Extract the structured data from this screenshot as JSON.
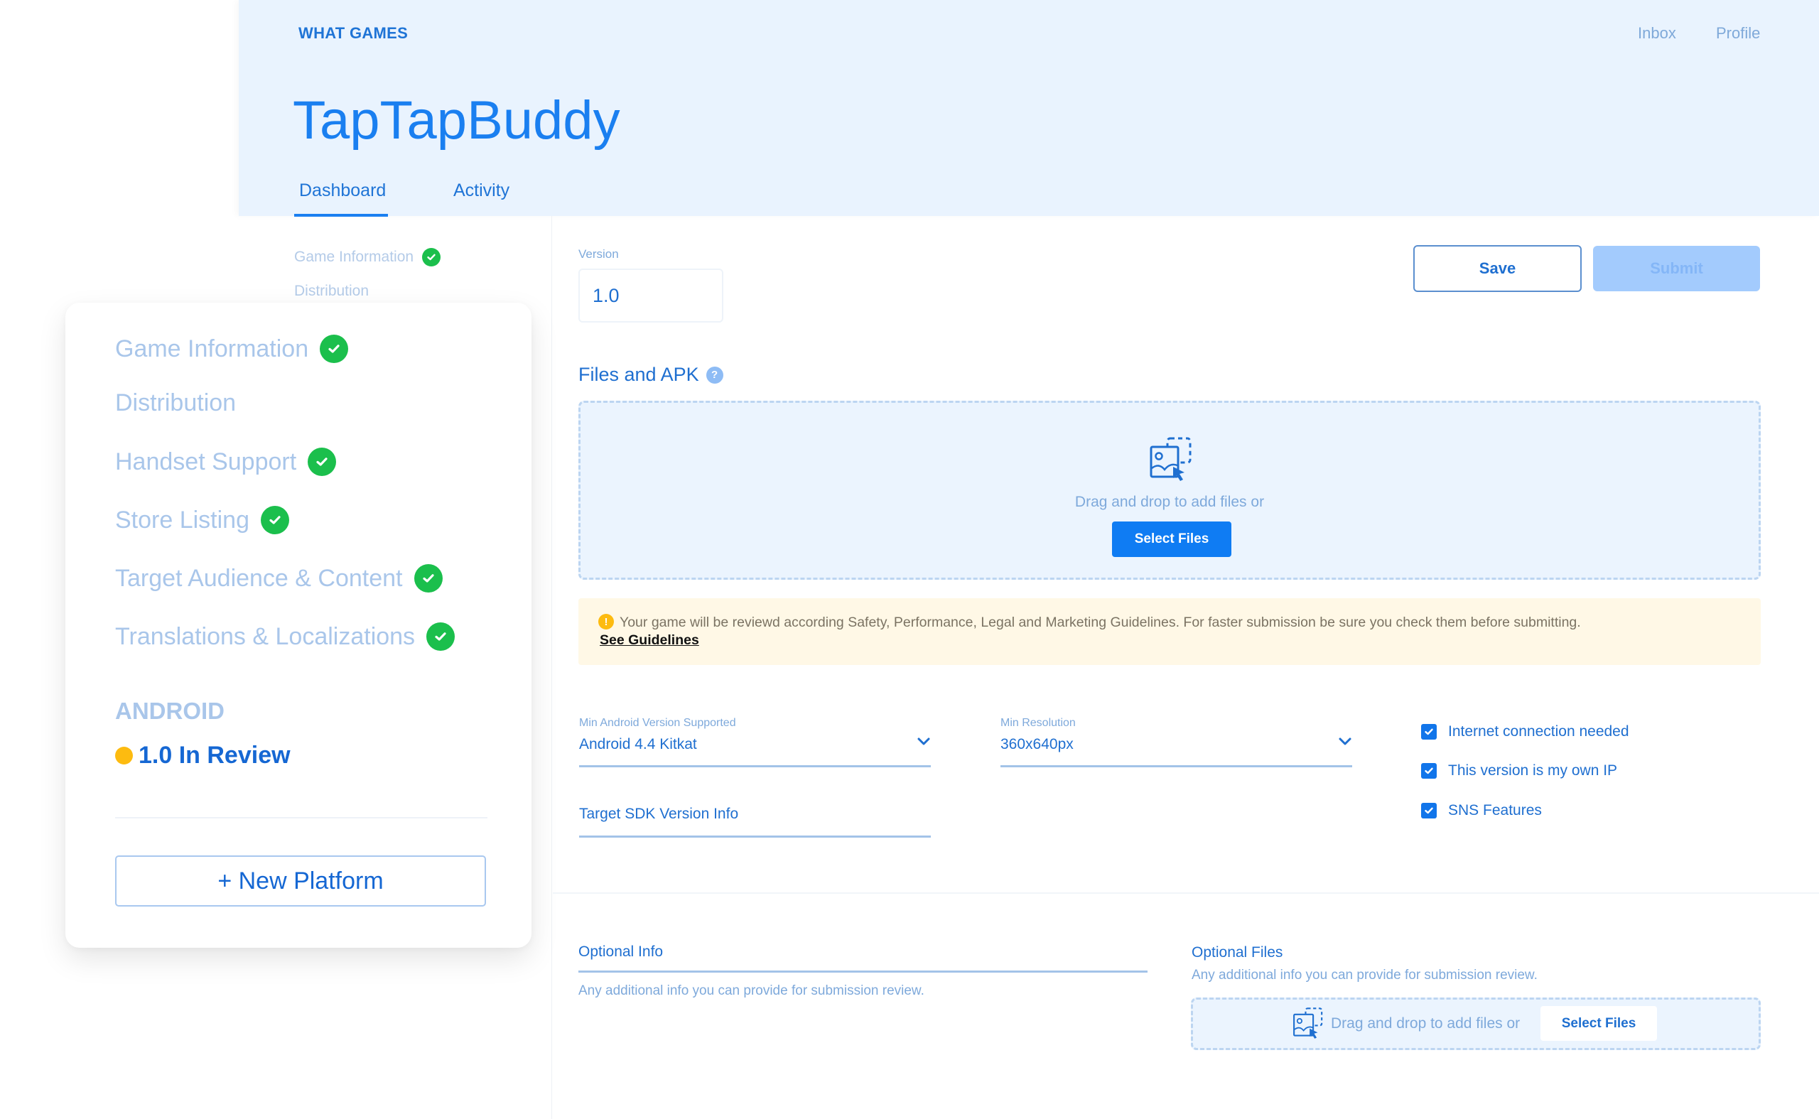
{
  "header": {
    "brand": "WHAT GAMES",
    "links": {
      "inbox": "Inbox",
      "profile": "Profile"
    },
    "title": "TapTapBuddy",
    "tabs": [
      {
        "label": "Dashboard",
        "active": true
      },
      {
        "label": "Activity",
        "active": false
      }
    ]
  },
  "faint_nav": {
    "items": [
      {
        "label": "Game Information",
        "complete": true,
        "icon": "check-circle-icon"
      },
      {
        "label": "Distribution",
        "complete": false
      }
    ]
  },
  "sidebar_card": {
    "items": [
      {
        "label": "Game Information",
        "complete": true,
        "icon": "check-circle-icon"
      },
      {
        "label": "Distribution",
        "complete": false
      },
      {
        "label": "Handset Support",
        "complete": true,
        "icon": "check-circle-icon"
      },
      {
        "label": "Store Listing",
        "complete": true,
        "icon": "check-circle-icon"
      },
      {
        "label": "Target Audience & Content",
        "complete": true,
        "icon": "check-circle-icon"
      },
      {
        "label": "Translations & Localizations",
        "complete": true,
        "icon": "check-circle-icon"
      }
    ],
    "platform": "ANDROID",
    "status": {
      "label": "1.0 In Review",
      "color": "#fdbb10"
    },
    "new_platform_label": "+ New Platform"
  },
  "form": {
    "version": {
      "label": "Version",
      "value": "1.0"
    },
    "save_label": "Save",
    "submit_label": "Submit",
    "files_section": {
      "title": "Files and APK",
      "help_icon": "question-circle-icon",
      "dropzone_text": "Drag and drop to add files or",
      "select_files_label": "Select Files",
      "dropzone_icon": "image-drag-drop-icon"
    },
    "notice": {
      "icon": "warning-circle-icon",
      "text": "Your game will be reviewd according Safety, Performance, Legal and Marketing Guidelines. For faster submission be sure you check them before submitting.",
      "link": "See Guidelines"
    },
    "min_android": {
      "label": "Min Android Version Supported",
      "value": "Android 4.4 Kitkat"
    },
    "min_resolution": {
      "label": "Min Resolution",
      "value": "360x640px"
    },
    "target_sdk": {
      "placeholder": "Target SDK Version Info",
      "value": ""
    },
    "checkboxes": [
      {
        "label": "Internet connection needed",
        "checked": true
      },
      {
        "label": "This version is my own IP",
        "checked": true
      },
      {
        "label": "SNS Features",
        "checked": true
      }
    ],
    "optional_info": {
      "placeholder": "Optional Info",
      "value": "",
      "help": "Any additional info you can provide for submission review."
    },
    "optional_files": {
      "title": "Optional Files",
      "help": "Any additional info you can provide for submission review.",
      "dropzone_text": "Drag and drop to add files or",
      "select_files_label": "Select Files"
    }
  },
  "colors": {
    "accent": "#1a7ff0",
    "header_bg": "#e9f3fe",
    "success": "#1bbf4c",
    "warning": "#fdbb10",
    "notice_bg": "#fff8e6",
    "primary_button": "#0f7cf3",
    "disabled_button": "#a3cbfd"
  }
}
